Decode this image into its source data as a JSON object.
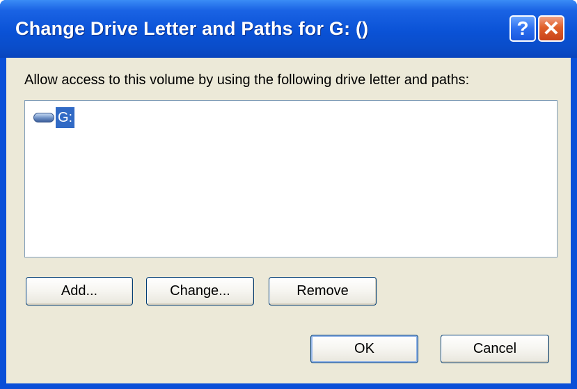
{
  "window": {
    "title": "Change Drive Letter and Paths for G: ()",
    "help_button": "?",
    "close_button": "✕"
  },
  "prompt": "Allow access to this volume by using the following drive letter and paths:",
  "list": {
    "items": [
      {
        "label": "G:",
        "icon": "drive-icon",
        "selected": true
      }
    ]
  },
  "buttons": {
    "add": "Add...",
    "change": "Change...",
    "remove": "Remove",
    "ok": "OK",
    "cancel": "Cancel"
  },
  "colors": {
    "titlebar": "#0a52d6",
    "selection": "#316ac5",
    "client_bg": "#ece9d8",
    "close": "#e0602a"
  }
}
